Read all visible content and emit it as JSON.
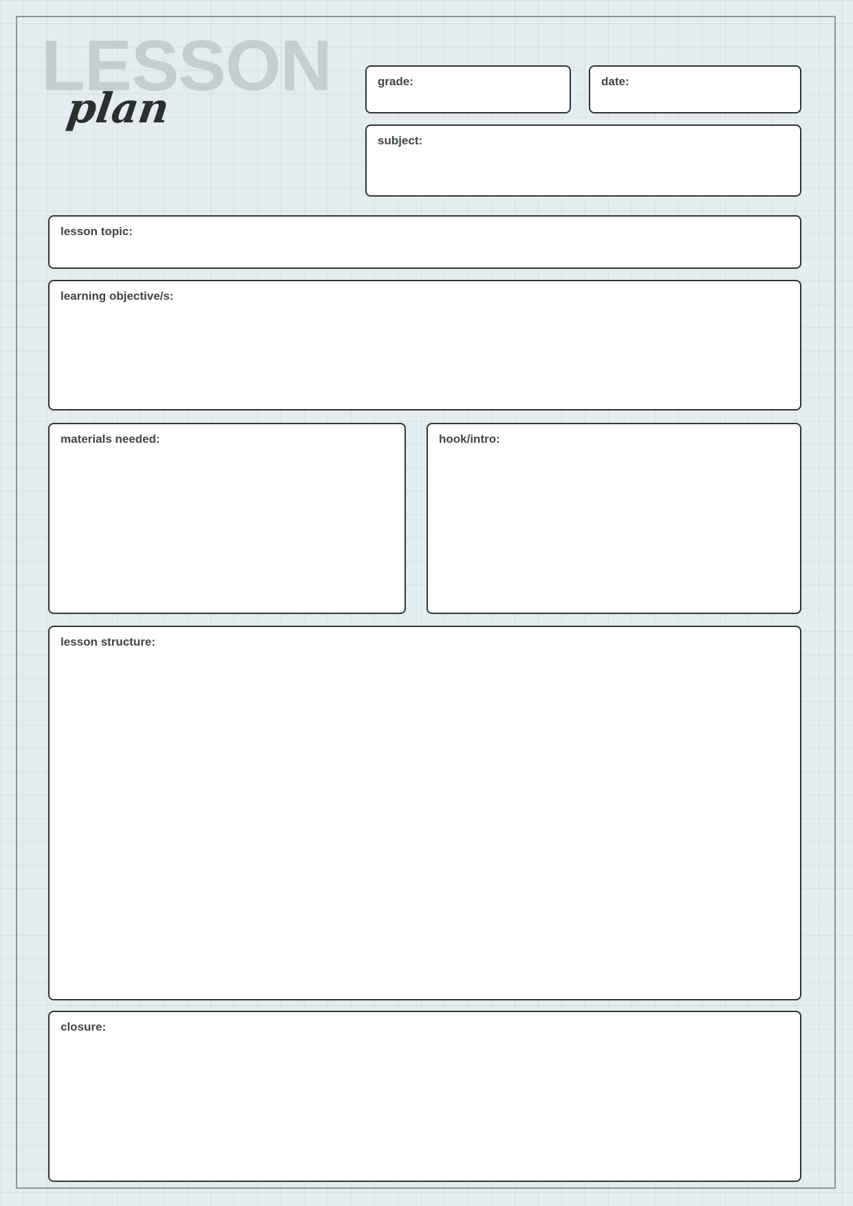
{
  "title": {
    "main": "LESSON",
    "script": "plan"
  },
  "fields": {
    "grade": "grade:",
    "date": "date:",
    "subject": "subject:",
    "lesson_topic": "lesson topic:",
    "learning_objectives": "learning objective/s:",
    "materials_needed": "materials needed:",
    "hook_intro": "hook/intro:",
    "lesson_structure": "lesson structure:",
    "closure": "closure:"
  }
}
